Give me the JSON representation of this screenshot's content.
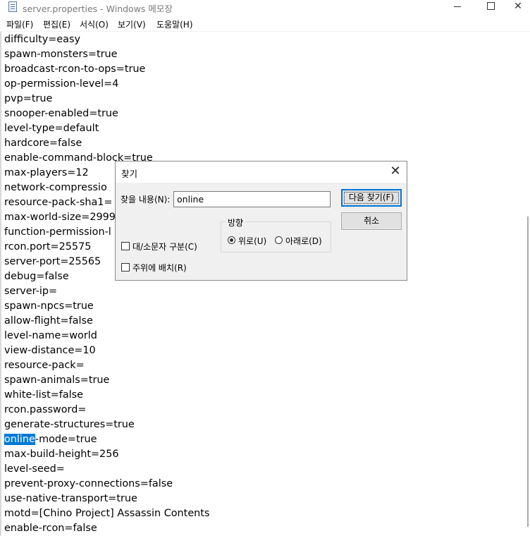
{
  "window": {
    "title": "server.properties - Windows 메모장",
    "controls": {
      "minimize": "─",
      "maximize": "☐",
      "close": "✕"
    }
  },
  "menu": [
    "파일(F)",
    "편집(E)",
    "서식(O)",
    "보기(V)",
    "도움말(H)"
  ],
  "editor": {
    "lines": [
      "difficulty=easy",
      "spawn-monsters=true",
      "broadcast-rcon-to-ops=true",
      "op-permission-level=4",
      "pvp=true",
      "snooper-enabled=true",
      "level-type=default",
      "hardcore=false",
      "enable-command-block=true",
      "max-players=12",
      "network-compressio",
      "resource-pack-sha1=",
      "max-world-size=2999",
      "function-permission-l",
      "rcon.port=25575",
      "server-port=25565",
      "debug=false",
      "server-ip=",
      "spawn-npcs=true",
      "allow-flight=false",
      "level-name=world",
      "view-distance=10",
      "resource-pack=",
      "spawn-animals=true",
      "white-list=false",
      "rcon.password=",
      "generate-structures=true",
      "online-mode=true",
      "max-build-height=256",
      "level-seed=",
      "prevent-proxy-connections=false",
      "use-native-transport=true",
      "motd=[Chino Project] Assassin Contents",
      "enable-rcon=false"
    ],
    "selected_line_index": 27,
    "selected_text": "online",
    "selected_rest": "-mode=true"
  },
  "find_dialog": {
    "title": "찾기",
    "close": "✕",
    "find_label": "찾을 내용(N):",
    "find_value": "online",
    "find_next_button": "다음 찾기(F)",
    "cancel_button": "취소",
    "direction_label": "방향",
    "direction_up": "위로(U)",
    "direction_down": "아래로(D)",
    "direction_selected": "up",
    "match_case": "대/소문자 구분(C)",
    "match_case_checked": false,
    "wrap_around": "주위에 배치(R)",
    "wrap_around_checked": false
  }
}
